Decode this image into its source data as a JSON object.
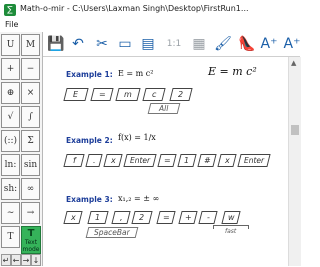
{
  "window": {
    "title": "Math-o-mir - C:\\Users\\Laxman Singh\\Desktop\\FirstRun1..."
  },
  "menu": {
    "file": "File"
  },
  "sidebar": {
    "cells": [
      {
        "name": "symbol-U-M-1",
        "label": "U"
      },
      {
        "name": "symbol-M",
        "label": "M"
      },
      {
        "name": "symbol-plus",
        "label": "+"
      },
      {
        "name": "symbol-minus",
        "label": "−"
      },
      {
        "name": "symbol-plus-circle",
        "label": "⊕"
      },
      {
        "name": "symbol-times",
        "label": "×"
      },
      {
        "name": "symbol-sqrt",
        "label": "√"
      },
      {
        "name": "symbol-integral",
        "label": "∫"
      },
      {
        "name": "symbol-paren",
        "label": "(::)"
      },
      {
        "name": "symbol-sum",
        "label": "Σ"
      },
      {
        "name": "symbol-ln",
        "label": "ln:"
      },
      {
        "name": "symbol-sin",
        "label": "sin"
      },
      {
        "name": "symbol-sh",
        "label": "sh:"
      },
      {
        "name": "symbol-inf",
        "label": "∞"
      },
      {
        "name": "symbol-wave",
        "label": "∼"
      },
      {
        "name": "symbol-arrow",
        "label": "→"
      },
      {
        "name": "symbol-T",
        "label": "T"
      }
    ],
    "text_mode": {
      "title": "T",
      "line1": "Text",
      "line2": "mode"
    },
    "arrows": [
      "↵",
      "←",
      "→",
      "↓"
    ]
  },
  "toolbar": {
    "buttons": [
      {
        "name": "save-icon",
        "glyph": "💾"
      },
      {
        "name": "undo-icon",
        "glyph": "↶"
      },
      {
        "name": "cut-icon",
        "glyph": "✂"
      },
      {
        "name": "copy-icon",
        "glyph": "▭"
      },
      {
        "name": "paste-icon",
        "glyph": "▤"
      },
      {
        "name": "fraction-icon",
        "glyph": "1:1"
      },
      {
        "name": "grid-icon",
        "glyph": "▦"
      },
      {
        "name": "color-icon",
        "glyph": "🖌"
      },
      {
        "name": "shoe-icon",
        "glyph": "👠"
      },
      {
        "name": "font-larger-icon",
        "glyph": "A⁺"
      },
      {
        "name": "font-larger2-icon",
        "glyph": "A⁺"
      }
    ]
  },
  "examples": [
    {
      "label": "Example 1:",
      "math": "E = m c²",
      "display": "E = m c²",
      "keys": [
        "E",
        "=",
        "m",
        "c",
        "2"
      ],
      "under": "All"
    },
    {
      "label": "Example 2:",
      "math": "f(x) = 1/x",
      "keys": [
        "f",
        ".",
        "x",
        "Enter",
        "=",
        "1",
        "#",
        "x",
        "Enter"
      ]
    },
    {
      "label": "Example 3:",
      "math": "x₁,₂ = ± ∞",
      "keys": [
        "x",
        "1",
        ",",
        "2",
        "=",
        "+",
        "-",
        "w"
      ],
      "under": "SpaceBar",
      "note": "fast"
    }
  ],
  "colors": {
    "accent": "#1d3e9a",
    "text_mode_bg": "#35b35a"
  }
}
